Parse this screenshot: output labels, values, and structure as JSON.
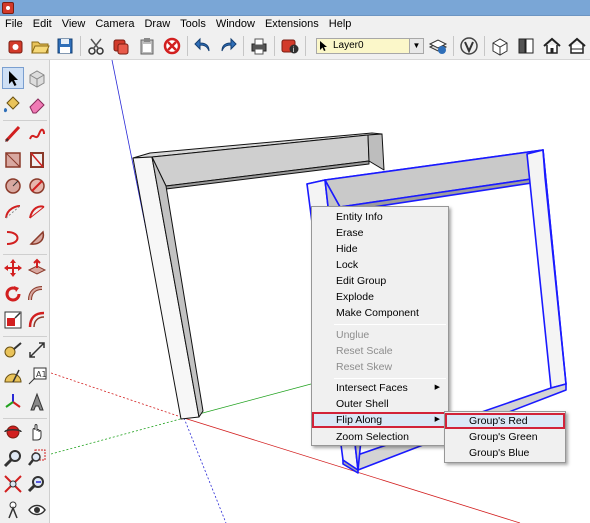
{
  "menubar": {
    "items": [
      "File",
      "Edit",
      "View",
      "Camera",
      "Draw",
      "Tools",
      "Window",
      "Extensions",
      "Help"
    ]
  },
  "toolbar": {
    "layer_value": "Layer0"
  },
  "context_menu": {
    "items": [
      {
        "label": "Entity Info",
        "enabled": true
      },
      {
        "label": "Erase",
        "enabled": true
      },
      {
        "label": "Hide",
        "enabled": true
      },
      {
        "label": "Lock",
        "enabled": true
      },
      {
        "label": "Edit Group",
        "enabled": true
      },
      {
        "label": "Explode",
        "enabled": true
      },
      {
        "label": "Make Component",
        "enabled": true
      },
      {
        "label": "Unglue",
        "enabled": false
      },
      {
        "label": "Reset Scale",
        "enabled": false
      },
      {
        "label": "Reset Skew",
        "enabled": false
      },
      {
        "label": "Intersect Faces",
        "enabled": true,
        "submenu": true
      },
      {
        "label": "Outer Shell",
        "enabled": true
      },
      {
        "label": "Flip Along",
        "enabled": true,
        "submenu": true,
        "highlighted": true
      },
      {
        "label": "Zoom Selection",
        "enabled": true
      }
    ]
  },
  "submenu": {
    "items": [
      {
        "label": "Group's Red",
        "highlighted": true
      },
      {
        "label": "Group's Green"
      },
      {
        "label": "Group's Blue"
      }
    ]
  },
  "colors": {
    "axis_red": "#d21f1f",
    "axis_green": "#21a21f",
    "axis_blue": "#2a2ad6",
    "selection_blue": "#1a1aff",
    "highlight_outline": "#d2233a"
  }
}
